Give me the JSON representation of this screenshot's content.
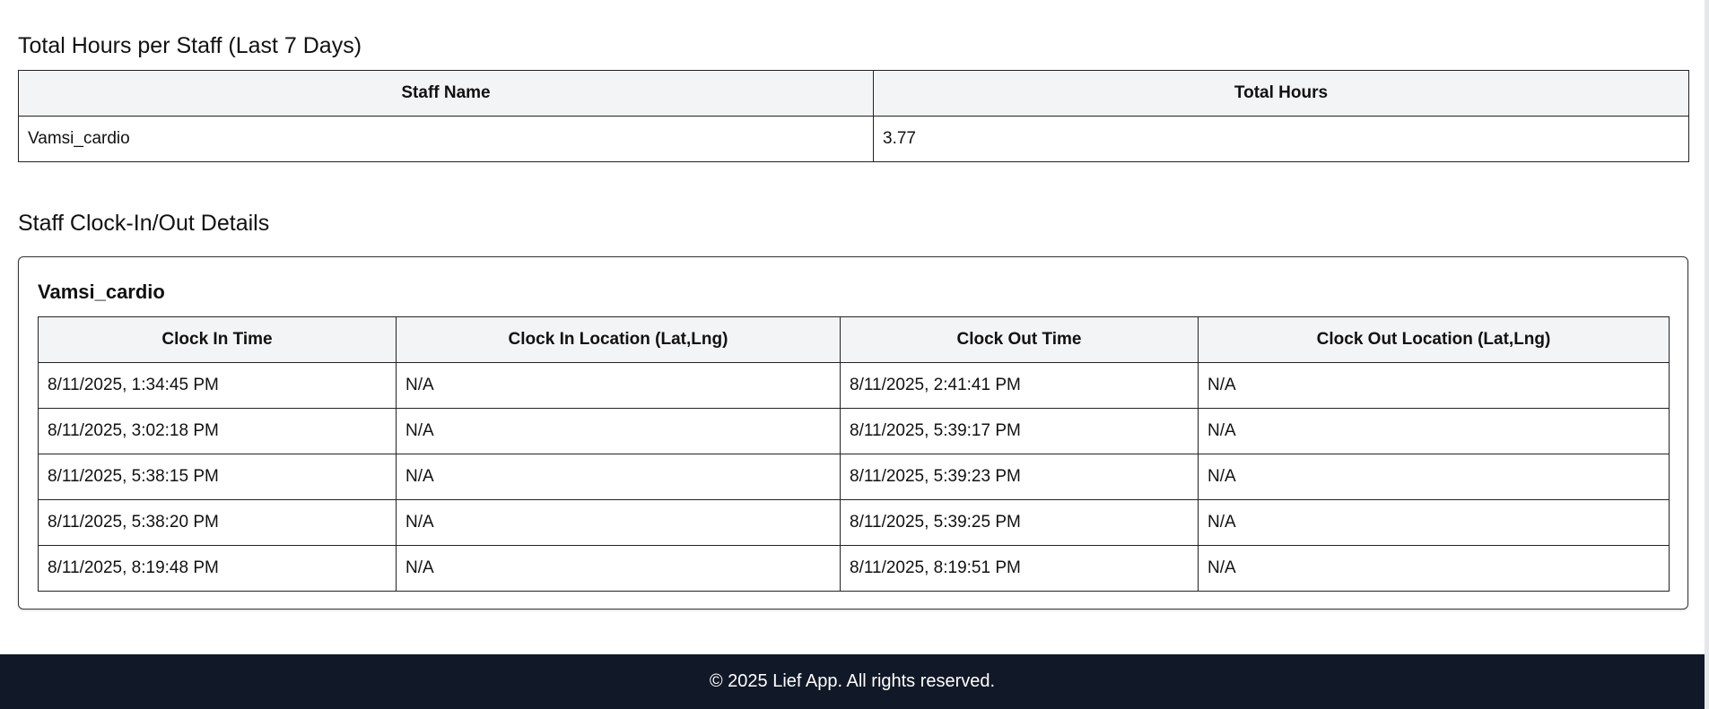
{
  "summary": {
    "title": "Total Hours per Staff (Last 7 Days)",
    "columns": [
      "Staff Name",
      "Total Hours"
    ],
    "rows": [
      [
        "Vamsi_cardio",
        "3.77"
      ]
    ]
  },
  "details": {
    "title": "Staff Clock-In/Out Details",
    "staff_name": "Vamsi_cardio",
    "columns": [
      "Clock In Time",
      "Clock In Location (Lat,Lng)",
      "Clock Out Time",
      "Clock Out Location (Lat,Lng)"
    ],
    "rows": [
      [
        "8/11/2025, 1:34:45 PM",
        "N/A",
        "8/11/2025, 2:41:41 PM",
        "N/A"
      ],
      [
        "8/11/2025, 3:02:18 PM",
        "N/A",
        "8/11/2025, 5:39:17 PM",
        "N/A"
      ],
      [
        "8/11/2025, 5:38:15 PM",
        "N/A",
        "8/11/2025, 5:39:23 PM",
        "N/A"
      ],
      [
        "8/11/2025, 5:38:20 PM",
        "N/A",
        "8/11/2025, 5:39:25 PM",
        "N/A"
      ],
      [
        "8/11/2025, 8:19:48 PM",
        "N/A",
        "8/11/2025, 8:19:51 PM",
        "N/A"
      ]
    ]
  },
  "footer": {
    "text": "© 2025 Lief App. All rights reserved."
  }
}
